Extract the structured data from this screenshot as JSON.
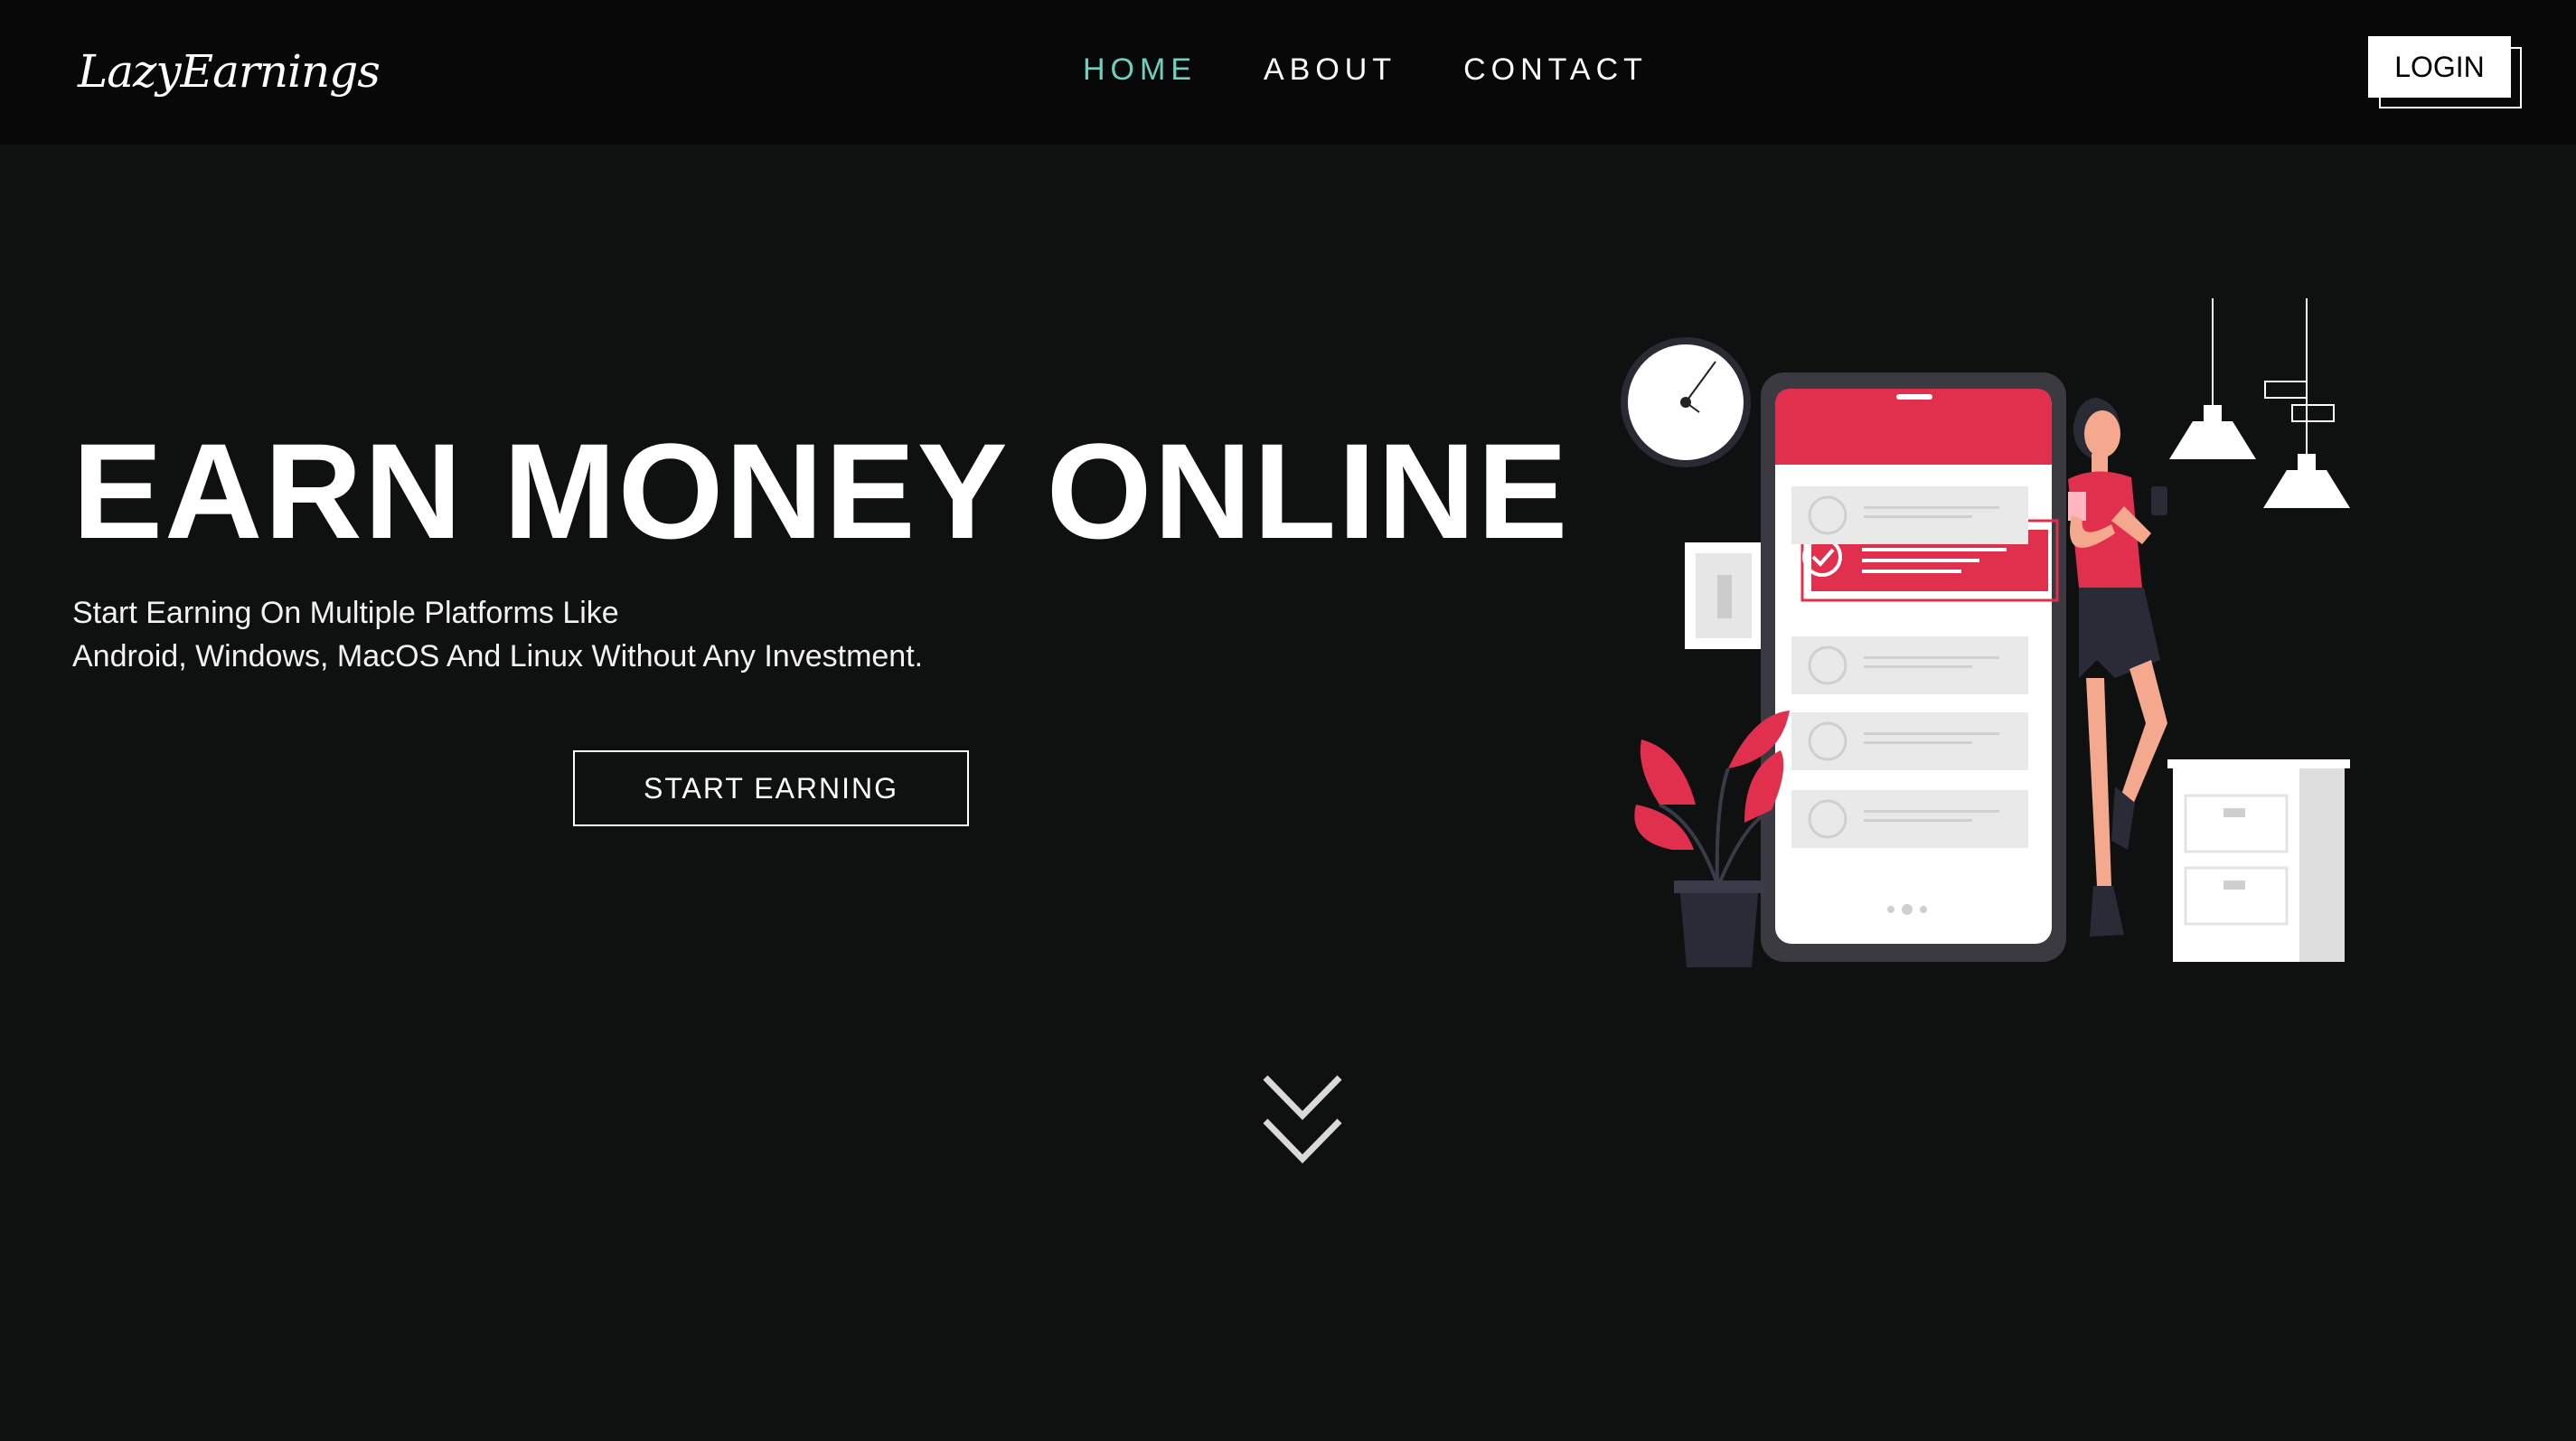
{
  "header": {
    "logo": "LazyEarnings",
    "nav": [
      {
        "label": "HOME",
        "active": true
      },
      {
        "label": "ABOUT",
        "active": false
      },
      {
        "label": "CONTACT",
        "active": false
      }
    ],
    "login_label": "LOGIN"
  },
  "hero": {
    "title": "EARN MONEY ONLINE",
    "subtitle_line1": "Start Earning On Multiple Platforms Like",
    "subtitle_line2": "Android, Windows, MacOS And Linux Without Any Investment.",
    "cta_label": "START EARNING"
  },
  "colors": {
    "background": "#0f1111",
    "header_bg": "#080808",
    "accent_nav": "#6fd0bf",
    "illustration_red": "#e0304e"
  },
  "icons": {
    "scroll": "double-chevron-down-icon"
  }
}
